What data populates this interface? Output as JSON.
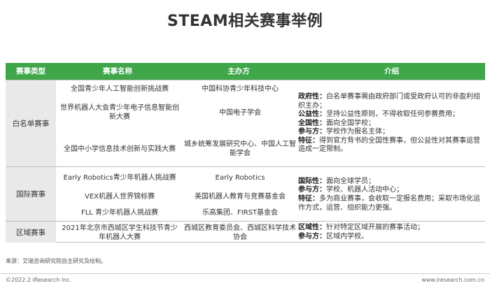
{
  "title": "STEAM相关赛事举例",
  "table": {
    "headers": [
      "赛事类型",
      "赛事名称",
      "主办方",
      "介绍"
    ],
    "sections": [
      {
        "category": "白名单赛事",
        "rows": [
          {
            "name": "全国青少年人工智能创新挑战赛",
            "organizer": "中国科协青少年科技中心"
          },
          {
            "name": "世界机器人大会青少年电子信息智能创新大赛",
            "organizer": "中国电子学会"
          },
          {
            "name": "全国中小学信息技术创新与实践大赛",
            "organizer": "城乡统筹发展研究中心、中国人工智能学会"
          }
        ],
        "intro": [
          {
            "label": "政府性：",
            "text": "白名单赛事需由政府部门或受政府认可的非盈利组织主办；"
          },
          {
            "label": "公益性：",
            "text": "坚持公益性原则，不得收取任何参赛费用；"
          },
          {
            "label": "全国性：",
            "text": "面向全国学校；"
          },
          {
            "label": "参与方：",
            "text": "学校作为报名主体；"
          },
          {
            "label": "特征：",
            "text": "得到官方背书的全国性赛事，但公益性对其赛事运营造成一定限制。"
          }
        ]
      },
      {
        "category": "国际赛事",
        "rows": [
          {
            "name": "Early Robotics青少年机器人挑战赛",
            "organizer": "Early Robotics"
          },
          {
            "name": "VEX机器人世界锦标赛",
            "organizer": "美国机器人教育与竞赛基金会"
          },
          {
            "name": "FLL 青少年机器人挑战赛",
            "organizer": "乐高集团、FIRST基金会"
          }
        ],
        "intro": [
          {
            "label": "国际性：",
            "text": "面向全球学员；"
          },
          {
            "label": "参与方：",
            "text": "学校、机器人活动中心；"
          },
          {
            "label": "特征：",
            "text": "多为商业赛事，会收取一定报名费用；采取市场化运作方式，运营、组织能力更强。"
          }
        ]
      },
      {
        "category": "区域赛事",
        "rows": [
          {
            "name": "2021年北京市西城区学生科技节青少年机器人大赛",
            "organizer": "西城区教育委员会、西城区科学技术协会"
          }
        ],
        "intro": [
          {
            "label": "区域性：",
            "text": "针对特定区域开展的赛事活动；"
          },
          {
            "label": "参与方：",
            "text": "区域内学校。"
          }
        ]
      }
    ]
  },
  "source": "来源：艾瑞咨询研究院自主研究及绘制。",
  "copyright": "©2022.2 iResearch Inc.",
  "website": "www.iresearch.com.cn"
}
